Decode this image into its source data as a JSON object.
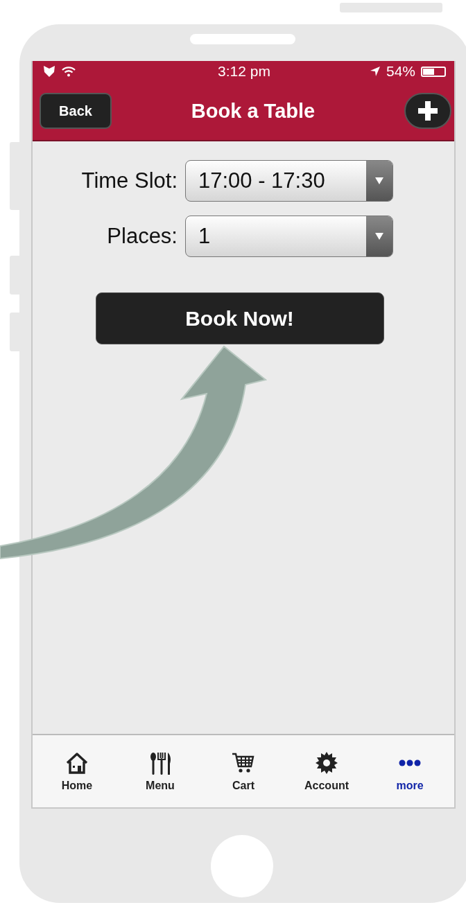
{
  "status_bar": {
    "time": "3:12 pm",
    "battery": "54%"
  },
  "nav_bar": {
    "back_button": "Back",
    "title": "Book a Table"
  },
  "form": {
    "fields": [
      {
        "label": "Time Slot:",
        "value": "17:00 - 17:30"
      },
      {
        "label": "Places:",
        "value": "1"
      }
    ],
    "submit_button": "Book Now!"
  },
  "tab_bar": {
    "items": [
      {
        "kind": "home",
        "label": "Home",
        "selected": false
      },
      {
        "kind": "menu",
        "label": "Menu",
        "selected": false
      },
      {
        "kind": "cart",
        "label": "Cart",
        "selected": false
      },
      {
        "kind": "account",
        "label": "Account",
        "selected": false
      },
      {
        "kind": "more",
        "label": "more",
        "selected": true
      }
    ]
  }
}
